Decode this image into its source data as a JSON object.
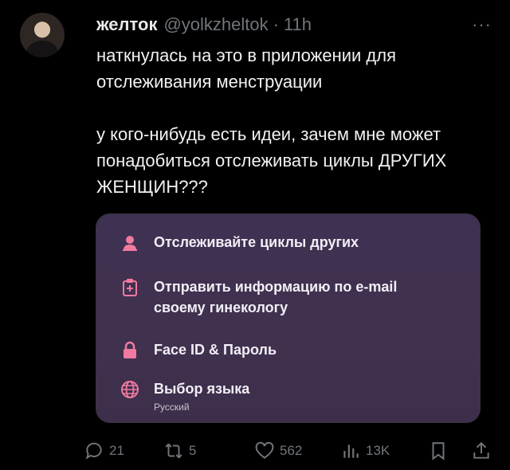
{
  "tweet": {
    "author_name": "желток",
    "handle": "@yolkzheltok",
    "separator": "·",
    "time": "11h",
    "more_label": "···",
    "text_lines_1": [
      "наткнулась на это в приложении для",
      "отслеживания менструации"
    ],
    "text_lines_2": [
      "у кого-нибудь есть идеи, зачем мне может",
      "понадобиться  отслеживать циклы ДРУГИХ",
      "ЖЕНЩИН???"
    ]
  },
  "card": {
    "background": "#40314f",
    "accent": "#f07aa0",
    "items": [
      {
        "icon": "person-icon",
        "title_lines": [
          "Отслеживайте циклы других"
        ],
        "subtitle": ""
      },
      {
        "icon": "clipboard-plus-icon",
        "title_lines": [
          "Отправить информацию по e-mail",
          "своему гинекологу"
        ],
        "subtitle": ""
      },
      {
        "icon": "lock-icon",
        "title_lines": [
          "Face ID & Пароль"
        ],
        "subtitle": ""
      },
      {
        "icon": "globe-icon",
        "title_lines": [
          "Выбор языка"
        ],
        "subtitle": "Русский"
      }
    ]
  },
  "actions": {
    "replies": "21",
    "retweets": "5",
    "likes": "562",
    "views": "13K"
  }
}
